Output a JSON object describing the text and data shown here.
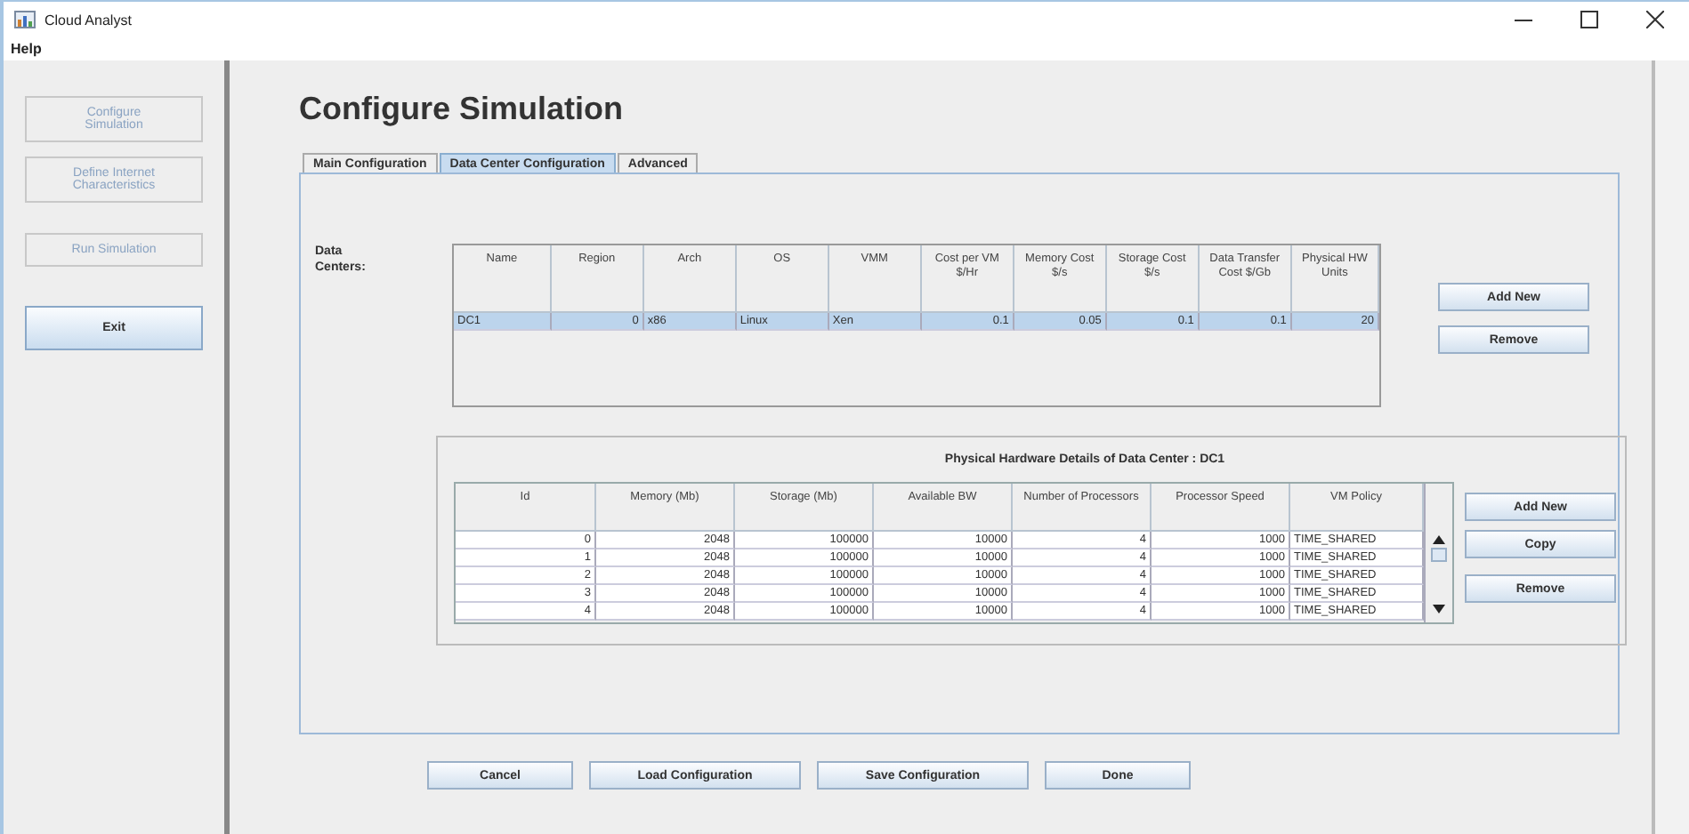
{
  "window": {
    "title": "Cloud Analyst"
  },
  "menu": [
    "Help"
  ],
  "sidebar": [
    {
      "label": "Configure Simulation",
      "disabled": true
    },
    {
      "label": "Define Internet Characteristics",
      "disabled": true
    },
    {
      "label": "Run Simulation",
      "disabled": true
    },
    {
      "label": "Exit",
      "disabled": false
    }
  ],
  "heading": "Configure Simulation",
  "tabs": [
    {
      "label": "Main Configuration",
      "selected": false
    },
    {
      "label": "Data Center Configuration",
      "selected": true
    },
    {
      "label": "Advanced",
      "selected": false
    }
  ],
  "data_centers": {
    "label": "Data Centers:",
    "columns": [
      "Name",
      "Region",
      "Arch",
      "OS",
      "VMM",
      "Cost per VM $/Hr",
      "Memory Cost $/s",
      "Storage Cost $/s",
      "Data Transfer Cost $/Gb",
      "Physical HW Units"
    ],
    "rows": [
      {
        "selected": true,
        "cells": [
          "DC1",
          "0",
          "x86",
          "Linux",
          "Xen",
          "0.1",
          "0.05",
          "0.1",
          "0.1",
          "20"
        ]
      }
    ],
    "buttons": [
      "Add New",
      "Remove"
    ]
  },
  "hardware": {
    "title": "Physical Hardware Details of Data Center : DC1",
    "columns": [
      "Id",
      "Memory (Mb)",
      "Storage (Mb)",
      "Available BW",
      "Number of Processors",
      "Processor Speed",
      "VM Policy"
    ],
    "rows": [
      {
        "selected": false,
        "cells": [
          "0",
          "2048",
          "100000",
          "10000",
          "4",
          "1000",
          "TIME_SHARED"
        ]
      },
      {
        "selected": false,
        "cells": [
          "1",
          "2048",
          "100000",
          "10000",
          "4",
          "1000",
          "TIME_SHARED"
        ]
      },
      {
        "selected": false,
        "cells": [
          "2",
          "2048",
          "100000",
          "10000",
          "4",
          "1000",
          "TIME_SHARED"
        ]
      },
      {
        "selected": false,
        "cells": [
          "3",
          "2048",
          "100000",
          "10000",
          "4",
          "1000",
          "TIME_SHARED"
        ]
      },
      {
        "selected": false,
        "cells": [
          "4",
          "2048",
          "100000",
          "10000",
          "4",
          "1000",
          "TIME_SHARED"
        ]
      }
    ],
    "buttons": [
      "Add New",
      "Copy",
      "Remove"
    ]
  },
  "footer_buttons": [
    "Cancel",
    "Load Configuration",
    "Save Configuration",
    "Done"
  ]
}
